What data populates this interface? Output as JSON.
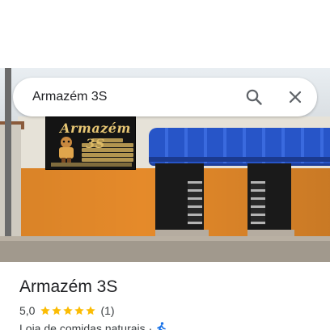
{
  "search": {
    "value": "Armazém 3S",
    "search_icon": "search-icon",
    "close_icon": "close-icon"
  },
  "photo": {
    "sign_title": "Armazém 3S",
    "awning_color": "#2755c8",
    "wall_color": "#e58a2a"
  },
  "place": {
    "name": "Armazém 3S",
    "rating": "5,0",
    "stars": 5,
    "review_count": "(1)",
    "category": "Loja de comidas naturais",
    "separator": "·",
    "travel_icon": "walking-icon"
  },
  "colors": {
    "star": "#fbbc04",
    "text_primary": "#202124",
    "text_secondary": "#3c4043",
    "accent": "#1a73e8"
  }
}
